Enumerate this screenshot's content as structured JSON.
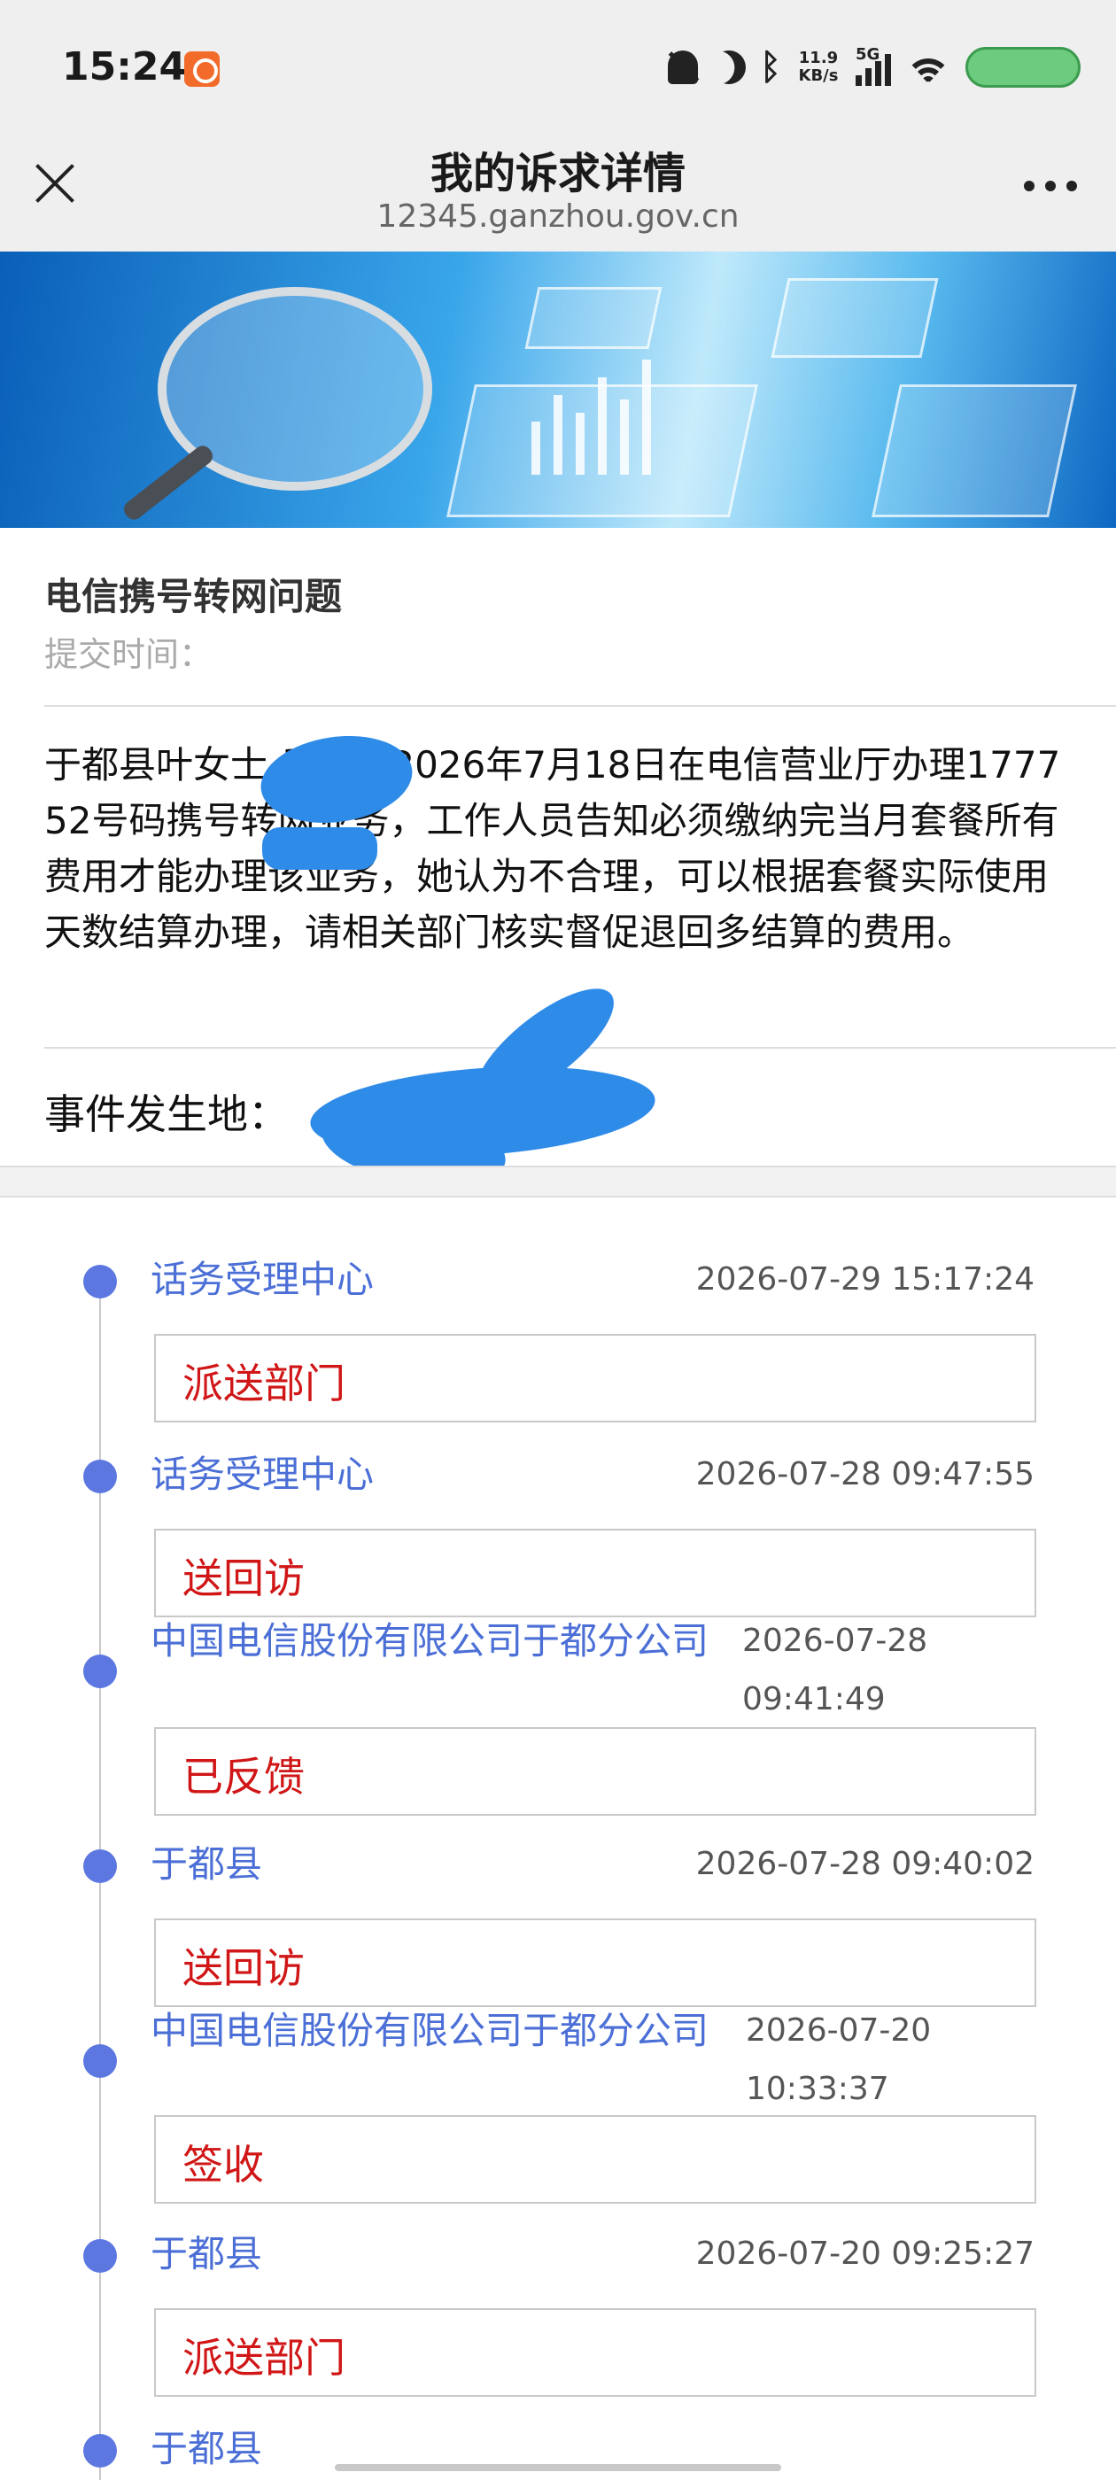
{
  "status_bar": {
    "time": "15:24",
    "network_speed_top": "11.9",
    "network_speed_bottom": "KB/s",
    "network_type": "5G",
    "icons": [
      "app-badge-icon",
      "mute-bell-icon",
      "moon-icon",
      "bluetooth-icon",
      "signal-icon",
      "wifi-icon",
      "battery-icon"
    ],
    "battery_color": "#6ccb7d"
  },
  "nav": {
    "title": "我的诉求详情",
    "url": "12345.ganzhou.gov.cn"
  },
  "request": {
    "title": "电信携号转网问题",
    "submit_time_label": "提交时间：",
    "description": "于都县叶女士        反映她2026年7月18日在电信营业厅办理1777          52号码携号转网业务，工作人员告知必须缴纳完当月套餐所有费用才能办理该业务，她认为不合理，可以根据套餐实际使用天数结算办理，请相关部门核实督促退回多结算的费用。",
    "location_label": "事件发生地："
  },
  "timeline": [
    {
      "org": "话务受理中心",
      "time": "2026-07-29 15:17:24",
      "status": "派送部门"
    },
    {
      "org": "话务受理中心",
      "time": "2026-07-28 09:47:55",
      "status": "送回访"
    },
    {
      "org": "中国电信股份有限公司于都分公司",
      "time": "2026-07-28 09:41:49",
      "status": "已反馈"
    },
    {
      "org": "于都县",
      "time": "2026-07-28 09:40:02",
      "status": "送回访"
    },
    {
      "org": "中国电信股份有限公司于都分公司",
      "time": "2026-07-20 10:33:37",
      "status": "签收"
    },
    {
      "org": "于都县",
      "time": "2026-07-20 09:25:27",
      "status": "派送部门"
    },
    {
      "org": "于都县",
      "time": "",
      "status": ""
    }
  ],
  "colors": {
    "accent_blue": "#4b6fd6",
    "timeline_dot": "#5c78e0",
    "status_red": "#d01616",
    "redaction_blue": "#2f8be8"
  }
}
